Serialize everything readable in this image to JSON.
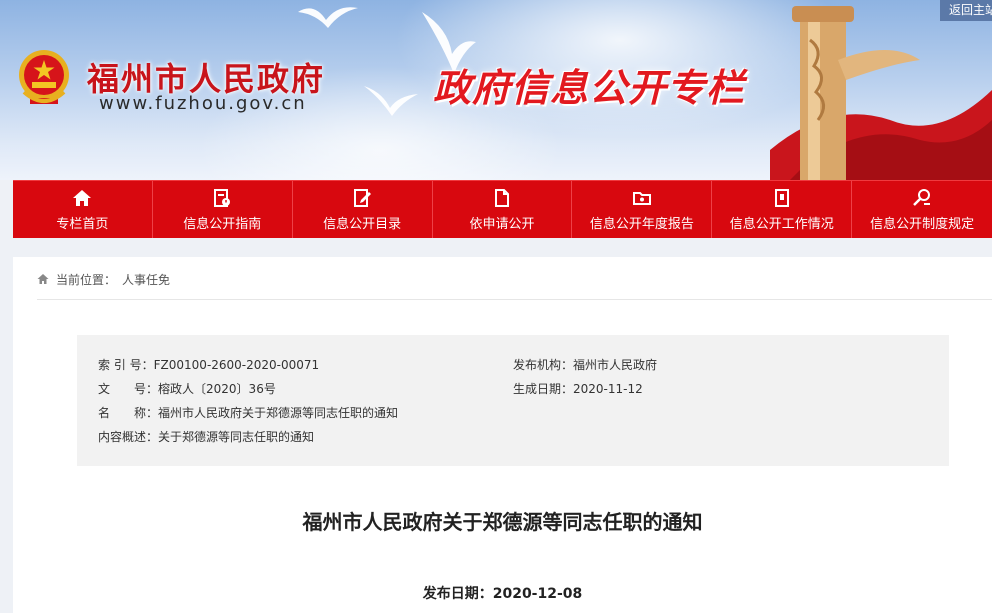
{
  "header": {
    "site_name": "福州市人民政府",
    "site_url": "www.fuzhou.gov.cn",
    "column_title": "政府信息公开专栏",
    "back_home": "返回主站"
  },
  "nav": {
    "items": [
      {
        "label": "专栏首页",
        "icon": "home-icon"
      },
      {
        "label": "信息公开指南",
        "icon": "guide-icon"
      },
      {
        "label": "信息公开目录",
        "icon": "catalog-icon"
      },
      {
        "label": "依申请公开",
        "icon": "document-icon"
      },
      {
        "label": "信息公开年度报告",
        "icon": "folder-icon"
      },
      {
        "label": "信息公开工作情况",
        "icon": "report-icon"
      },
      {
        "label": "信息公开制度规定",
        "icon": "search-regulation-icon"
      }
    ]
  },
  "breadcrumb": {
    "label": "当前位置：",
    "current": "人事任免"
  },
  "meta": {
    "index_label": "索 引 号：",
    "index_value": "FZ00100-2600-2020-00071",
    "publisher_label": "发布机构：",
    "publisher_value": "福州市人民政府",
    "doc_no_label": "文　　号：",
    "doc_no_value": "榕政人〔2020〕36号",
    "created_label": "生成日期：",
    "created_value": "2020-11-12",
    "name_label": "名　　称：",
    "name_value": "福州市人民政府关于郑德源等同志任职的通知",
    "summary_label": "内容概述：",
    "summary_value": "关于郑德源等同志任职的通知"
  },
  "article": {
    "title": "福州市人民政府关于郑德源等同志任职的通知",
    "pubdate_label": "发布日期：",
    "pubdate_value": "2020-12-08"
  },
  "colors": {
    "brand_red": "#d8080f",
    "title_red": "#e2191f",
    "meta_bg": "#f2f2f2"
  }
}
